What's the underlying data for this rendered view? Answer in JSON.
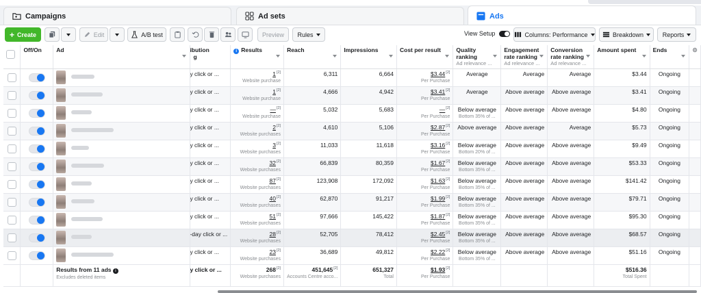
{
  "tabs": [
    {
      "label": "Campaigns",
      "icon": "folder-icon"
    },
    {
      "label": "Ad sets",
      "icon": "grid-icon"
    },
    {
      "label": "Ads",
      "icon": "ad-icon"
    }
  ],
  "toolbar": {
    "create": "Create",
    "edit": "Edit",
    "ab_test": "A/B test",
    "preview": "Preview",
    "rules": "Rules",
    "view_setup": "View Setup",
    "columns": "Columns: Performance",
    "breakdown": "Breakdown",
    "reports": "Reports"
  },
  "columns": {
    "off_on": "Off/On",
    "ad": "Ad",
    "attribution": "ibution\ng",
    "results": "Results",
    "reach": "Reach",
    "impressions": "Impressions",
    "cost_per_result": "Cost per result",
    "quality": "Quality ranking",
    "quality_sub": "Ad relevance ...",
    "engagement": "Engagement rate ranking",
    "engagement_sub": "Ad relevance ...",
    "conversion": "Conversion rate ranking",
    "conversion_sub": "Ad relevance ...",
    "spent": "Amount spent",
    "ends": "Ends"
  },
  "rows": [
    {
      "attr": "y click or ...",
      "results": "1",
      "results_sub": "Website purchase",
      "reach": "6,311",
      "impr": "6,664",
      "cpr": "$3.44",
      "cpr_sub": "Per Purchase",
      "q": "Average",
      "q_sub": "",
      "e": "Average",
      "c": "Average",
      "spent": "$3.44",
      "ends": "Ongoing"
    },
    {
      "attr": "y click or ...",
      "results": "1",
      "results_sub": "Website purchase",
      "reach": "4,666",
      "impr": "4,942",
      "cpr": "$3.41",
      "cpr_sub": "Per Purchase",
      "q": "Average",
      "q_sub": "",
      "e": "Above average",
      "c": "Above average",
      "spent": "$3.41",
      "ends": "Ongoing"
    },
    {
      "attr": "y click or ...",
      "results": "—",
      "results_sub": "Website purchase",
      "reach": "5,032",
      "impr": "5,683",
      "cpr": "—",
      "cpr_sub": "Per Purchase",
      "q": "Below average",
      "q_sub": "Bottom 35% of ...",
      "e": "Above average",
      "c": "Above average",
      "spent": "$4.80",
      "ends": "Ongoing"
    },
    {
      "attr": "y click or ...",
      "results": "2",
      "results_sub": "Website purchases",
      "reach": "4,610",
      "impr": "5,106",
      "cpr": "$2.87",
      "cpr_sub": "Per Purchase",
      "q": "Above average",
      "q_sub": "",
      "e": "Above average",
      "c": "Average",
      "spent": "$5.73",
      "ends": "Ongoing"
    },
    {
      "attr": "y click or ...",
      "results": "3",
      "results_sub": "Website purchases",
      "reach": "11,033",
      "impr": "11,618",
      "cpr": "$3.16",
      "cpr_sub": "Per Purchase",
      "q": "Below average",
      "q_sub": "Bottom 20% of ...",
      "e": "Above average",
      "c": "Above average",
      "spent": "$9.49",
      "ends": "Ongoing"
    },
    {
      "attr": "y click or ...",
      "results": "32",
      "results_sub": "Website purchases",
      "reach": "66,839",
      "impr": "80,359",
      "cpr": "$1.67",
      "cpr_sub": "Per Purchase",
      "q": "Below average",
      "q_sub": "Bottom 35% of ...",
      "e": "Above average",
      "c": "Above average",
      "spent": "$53.33",
      "ends": "Ongoing"
    },
    {
      "attr": "y click or ...",
      "results": "87",
      "results_sub": "Website purchases",
      "reach": "123,908",
      "impr": "172,092",
      "cpr": "$1.63",
      "cpr_sub": "Per Purchase",
      "q": "Below average",
      "q_sub": "Bottom 35% of ...",
      "e": "Above average",
      "c": "Above average",
      "spent": "$141.42",
      "ends": "Ongoing"
    },
    {
      "attr": "y click or ...",
      "results": "40",
      "results_sub": "Website purchases",
      "reach": "62,870",
      "impr": "91,217",
      "cpr": "$1.99",
      "cpr_sub": "Per Purchase",
      "q": "Below average",
      "q_sub": "Bottom 35% of ...",
      "e": "Above average",
      "c": "Above average",
      "spent": "$79.71",
      "ends": "Ongoing"
    },
    {
      "attr": "y click or ...",
      "results": "51",
      "results_sub": "Website purchases",
      "reach": "97,666",
      "impr": "145,422",
      "cpr": "$1.87",
      "cpr_sub": "Per Purchase",
      "q": "Below average",
      "q_sub": "Bottom 35% of ...",
      "e": "Above average",
      "c": "Above average",
      "spent": "$95.30",
      "ends": "Ongoing"
    },
    {
      "attr": "-day click or ...",
      "results": "28",
      "results_sub": "Website purchases",
      "reach": "52,705",
      "impr": "78,412",
      "cpr": "$2.45",
      "cpr_sub": "Per Purchase",
      "q": "Below average",
      "q_sub": "Bottom 35% of ...",
      "e": "Above average",
      "c": "Above average",
      "spent": "$68.57",
      "ends": "Ongoing"
    },
    {
      "attr": "y click or ...",
      "results": "23",
      "results_sub": "Website purchases",
      "reach": "36,689",
      "impr": "49,812",
      "cpr": "$2.22",
      "cpr_sub": "Per Purchase",
      "q": "Below average",
      "q_sub": "Bottom 35% of ...",
      "e": "Above average",
      "c": "Above average",
      "spent": "$51.16",
      "ends": "Ongoing"
    }
  ],
  "totals": {
    "label": "Results from 11 ads",
    "label_sub": "Excludes deleted items",
    "attr": "y click or ...",
    "results": "268",
    "results_sub": "Website purchases",
    "reach": "451,645",
    "reach_sub": "Accounts Centre acco...",
    "impr": "651,327",
    "impr_sub": "Total",
    "cpr": "$1.93",
    "cpr_sub": "Per Purchase",
    "spent": "$516.36",
    "spent_sub": "Total Spent"
  }
}
